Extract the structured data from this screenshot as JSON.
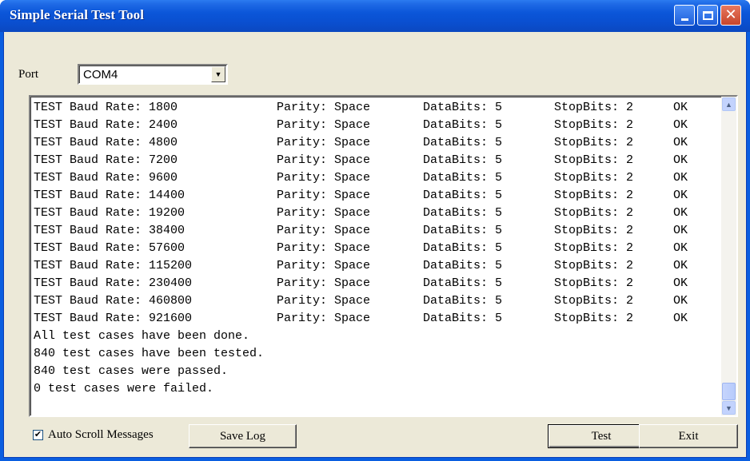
{
  "window": {
    "title": "Simple Serial Test Tool",
    "controls": {
      "minimize_icon": "minimize-icon",
      "maximize_icon": "maximize-icon",
      "close_icon": "close-icon"
    },
    "colors": {
      "title_bar": "#0a4fd0",
      "body": "#ece9d8",
      "close": "#c7452a"
    }
  },
  "port": {
    "label": "Port",
    "value": "COM4",
    "arrow": "▼"
  },
  "log": {
    "rows": [
      {
        "test": "TEST Baud Rate: 1800",
        "parity": "Parity: Space",
        "databits": "DataBits: 5",
        "stopbits": "StopBits: 2",
        "result": "OK"
      },
      {
        "test": "TEST Baud Rate: 2400",
        "parity": "Parity: Space",
        "databits": "DataBits: 5",
        "stopbits": "StopBits: 2",
        "result": "OK"
      },
      {
        "test": "TEST Baud Rate: 4800",
        "parity": "Parity: Space",
        "databits": "DataBits: 5",
        "stopbits": "StopBits: 2",
        "result": "OK"
      },
      {
        "test": "TEST Baud Rate: 7200",
        "parity": "Parity: Space",
        "databits": "DataBits: 5",
        "stopbits": "StopBits: 2",
        "result": "OK"
      },
      {
        "test": "TEST Baud Rate: 9600",
        "parity": "Parity: Space",
        "databits": "DataBits: 5",
        "stopbits": "StopBits: 2",
        "result": "OK"
      },
      {
        "test": "TEST Baud Rate: 14400",
        "parity": "Parity: Space",
        "databits": "DataBits: 5",
        "stopbits": "StopBits: 2",
        "result": "OK"
      },
      {
        "test": "TEST Baud Rate: 19200",
        "parity": "Parity: Space",
        "databits": "DataBits: 5",
        "stopbits": "StopBits: 2",
        "result": "OK"
      },
      {
        "test": "TEST Baud Rate: 38400",
        "parity": "Parity: Space",
        "databits": "DataBits: 5",
        "stopbits": "StopBits: 2",
        "result": "OK"
      },
      {
        "test": "TEST Baud Rate: 57600",
        "parity": "Parity: Space",
        "databits": "DataBits: 5",
        "stopbits": "StopBits: 2",
        "result": "OK"
      },
      {
        "test": "TEST Baud Rate: 115200",
        "parity": "Parity: Space",
        "databits": "DataBits: 5",
        "stopbits": "StopBits: 2",
        "result": "OK"
      },
      {
        "test": "TEST Baud Rate: 230400",
        "parity": "Parity: Space",
        "databits": "DataBits: 5",
        "stopbits": "StopBits: 2",
        "result": "OK"
      },
      {
        "test": "TEST Baud Rate: 460800",
        "parity": "Parity: Space",
        "databits": "DataBits: 5",
        "stopbits": "StopBits: 2",
        "result": "OK"
      },
      {
        "test": "TEST Baud Rate: 921600",
        "parity": "Parity: Space",
        "databits": "DataBits: 5",
        "stopbits": "StopBits: 2",
        "result": "OK"
      }
    ],
    "summary": [
      "All test cases have been done.",
      "840 test cases have been tested.",
      "840 test cases were passed.",
      "0 test cases were failed."
    ],
    "scroll": {
      "up_icon": "scroll-up-icon",
      "down_icon": "scroll-down-icon",
      "up_glyph": "▲",
      "down_glyph": "▼",
      "position": 1.0
    }
  },
  "footer": {
    "auto_scroll": {
      "label": "Auto Scroll Messages",
      "checked": true,
      "check_glyph": "✔"
    },
    "save_log_label": "Save Log",
    "test_label": "Test",
    "exit_label": "Exit"
  }
}
